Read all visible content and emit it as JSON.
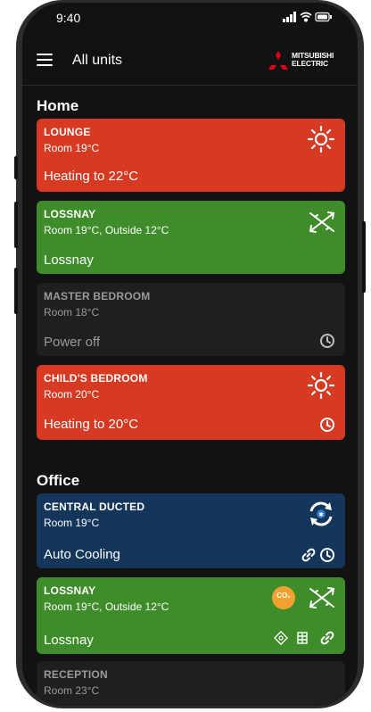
{
  "status_bar": {
    "time": "9:40",
    "indicators": "signal wifi battery"
  },
  "header": {
    "title": "All units",
    "brand": [
      "MITSUBISHI",
      "ELECTRIC"
    ]
  },
  "sections": [
    {
      "title": "Home",
      "units": [
        {
          "name": "LOUNGE",
          "room": "Room 19°C",
          "status": "Heating to 22°C",
          "color": "#d63a22",
          "icons": [
            "sun-icon"
          ]
        },
        {
          "name": "LOSSNAY",
          "room": "Room 19°C, Outside 12°C",
          "status": "Lossnay",
          "color": "#3f8c2a",
          "icons": [
            "ventilation-icon"
          ]
        },
        {
          "name": "MASTER BEDROOM",
          "room": "Room 18°C",
          "status": "Power off",
          "color": "#1f1f1f",
          "icons": [
            "clock-icon"
          ]
        },
        {
          "name": "CHILD'S BEDROOM",
          "room": "Room 20°C",
          "status": "Heating to 20°C",
          "color": "#d63a22",
          "icons": [
            "sun-icon",
            "clock-icon"
          ]
        }
      ]
    },
    {
      "title": "Office",
      "units": [
        {
          "name": "CENTRAL DUCTED",
          "room": "Room 19°C",
          "status": "Auto Cooling",
          "color": "#13365a",
          "icons": [
            "auto-cool-icon",
            "link-icon",
            "clock-icon"
          ]
        },
        {
          "name": "LOSSNAY",
          "room": "Room 19°C, Outside 12°C",
          "status": "Lossnay",
          "color": "#3f8c2a",
          "icons": [
            "co2-icon",
            "ventilation-icon",
            "sensor-icon",
            "filter-icon",
            "link-icon"
          ],
          "badge": "CO₂"
        },
        {
          "name": "RECEPTION",
          "room": "Room 23°C",
          "color": "#1f1f1f"
        }
      ]
    }
  ]
}
